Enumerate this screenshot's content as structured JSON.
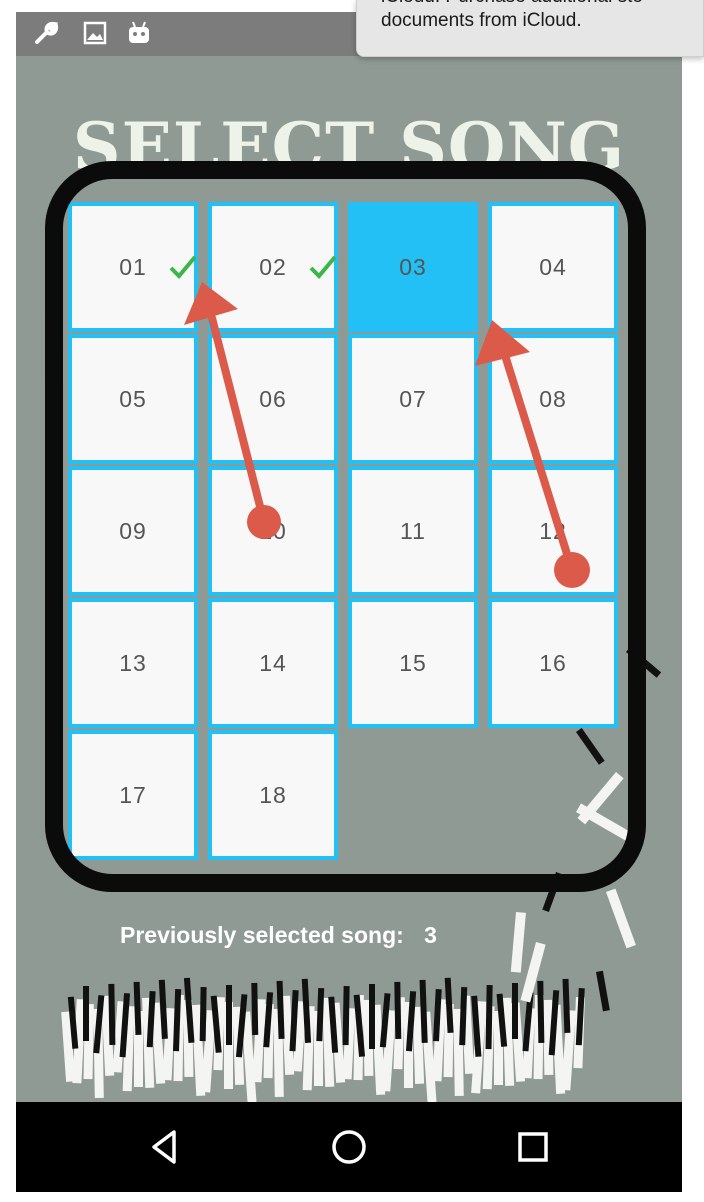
{
  "notification": {
    "line1": "iCloud. Purchase additional sto",
    "line2": "documents from iCloud."
  },
  "status_bar": {
    "icons": [
      "wrench-icon",
      "image-icon",
      "android-icon"
    ]
  },
  "title": "SELECT SONG",
  "songs": [
    {
      "label": "01",
      "completed": true,
      "selected": false
    },
    {
      "label": "02",
      "completed": true,
      "selected": false
    },
    {
      "label": "03",
      "completed": false,
      "selected": true
    },
    {
      "label": "04",
      "completed": false,
      "selected": false
    },
    {
      "label": "05",
      "completed": false,
      "selected": false
    },
    {
      "label": "06",
      "completed": false,
      "selected": false
    },
    {
      "label": "07",
      "completed": false,
      "selected": false
    },
    {
      "label": "08",
      "completed": false,
      "selected": false
    },
    {
      "label": "09",
      "completed": false,
      "selected": false
    },
    {
      "label": "10",
      "completed": false,
      "selected": false
    },
    {
      "label": "11",
      "completed": false,
      "selected": false
    },
    {
      "label": "12",
      "completed": false,
      "selected": false
    },
    {
      "label": "13",
      "completed": false,
      "selected": false
    },
    {
      "label": "14",
      "completed": false,
      "selected": false
    },
    {
      "label": "15",
      "completed": false,
      "selected": false
    },
    {
      "label": "16",
      "completed": false,
      "selected": false
    },
    {
      "label": "17",
      "completed": false,
      "selected": false
    },
    {
      "label": "18",
      "completed": false,
      "selected": false
    }
  ],
  "previous": {
    "label": "Previously selected song:",
    "value": "3"
  },
  "nav_bar": {
    "icons": [
      "back-icon",
      "home-icon",
      "recents-icon"
    ]
  },
  "colors": {
    "accent": "#23c0f5",
    "check": "#3cb64a",
    "annotation": "#dc5a4a",
    "background": "#8e9a93"
  }
}
